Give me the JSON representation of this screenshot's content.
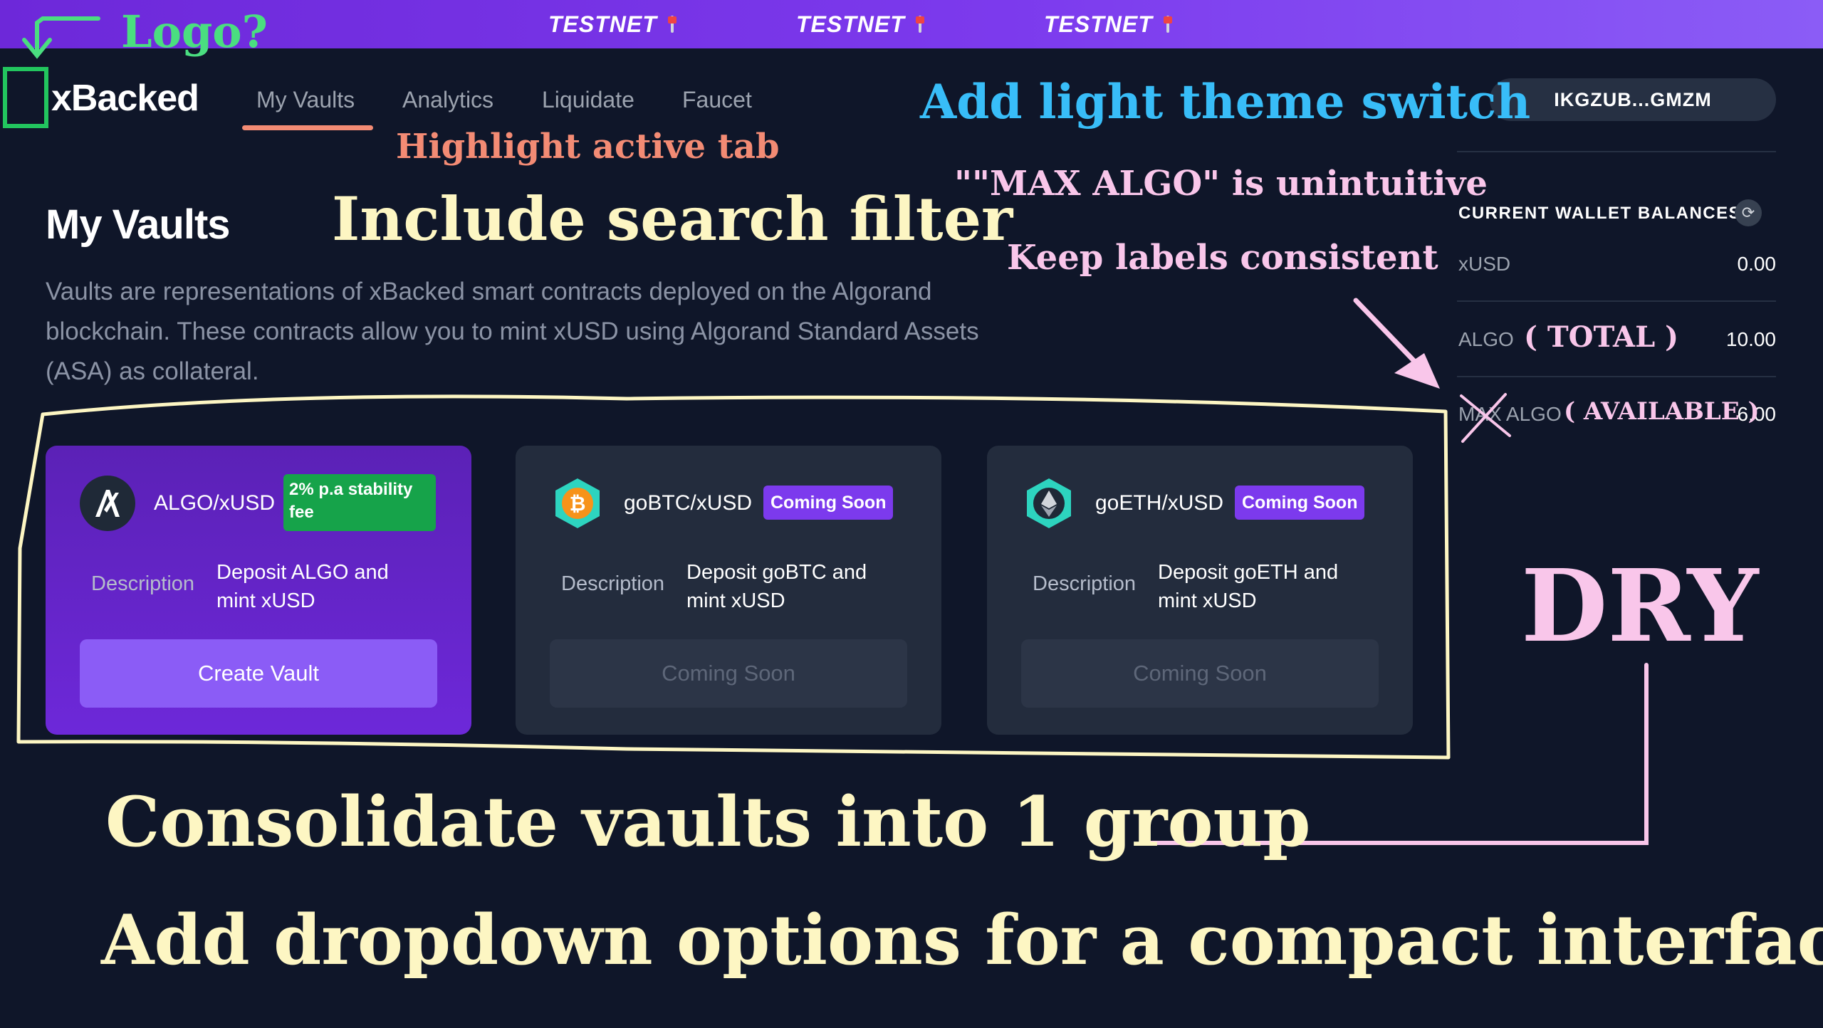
{
  "banner": {
    "items": [
      "TESTNET",
      "TESTNET",
      "TESTNET"
    ],
    "icon": "joystick-icon"
  },
  "header": {
    "brand": "xBacked",
    "nav": [
      {
        "label": "My Vaults",
        "active": true
      },
      {
        "label": "Analytics",
        "active": false
      },
      {
        "label": "Liquidate",
        "active": false
      },
      {
        "label": "Faucet",
        "active": false
      }
    ],
    "wallet_address": "IKGZUB...GMZM",
    "active_color": "#f38b74"
  },
  "page": {
    "title": "My Vaults",
    "description": "Vaults are representations of xBacked smart contracts deployed on the Algorand blockchain. These contracts allow you to mint xUSD using Algorand Standard Assets (ASA) as collateral."
  },
  "vaults": [
    {
      "pair": "ALGO/xUSD",
      "badge": "2% p.a stability fee",
      "badge_color": "#16a34a",
      "desc_label": "Description",
      "desc_text": "Deposit ALGO and mint xUSD",
      "button": "Create Vault",
      "icon": "algorand-icon",
      "enabled": true
    },
    {
      "pair": "goBTC/xUSD",
      "badge": "Coming Soon",
      "badge_color": "#7c3aed",
      "desc_label": "Description",
      "desc_text": "Deposit goBTC and mint xUSD",
      "button": "Coming Soon",
      "icon": "bitcoin-icon",
      "enabled": false
    },
    {
      "pair": "goETH/xUSD",
      "badge": "Coming Soon",
      "badge_color": "#7c3aed",
      "desc_label": "Description",
      "desc_text": "Deposit goETH and mint xUSD",
      "button": "Coming Soon",
      "icon": "ethereum-icon",
      "enabled": false
    }
  ],
  "wallet_balances": {
    "title": "CURRENT WALLET BALANCES",
    "rows": [
      {
        "label": "xUSD",
        "value": "0.00"
      },
      {
        "label": "ALGO",
        "value": "10.00"
      },
      {
        "label": "MAX ALGO",
        "value": "6.00"
      }
    ]
  },
  "annotations": {
    "logo": "Logo?",
    "theme": "Add light theme switch",
    "active_tab": "Highlight active tab",
    "search": "Include search filter",
    "max_algo": "\"\"MAX ALGO\" is unintuitive",
    "labels": "Keep labels consistent",
    "total": "( TOTAL )",
    "available": "( AVAILABLE )",
    "dry": "DRY",
    "consolidate": "Consolidate vaults into 1 group",
    "dropdown": "Add dropdown options for a compact interface"
  }
}
